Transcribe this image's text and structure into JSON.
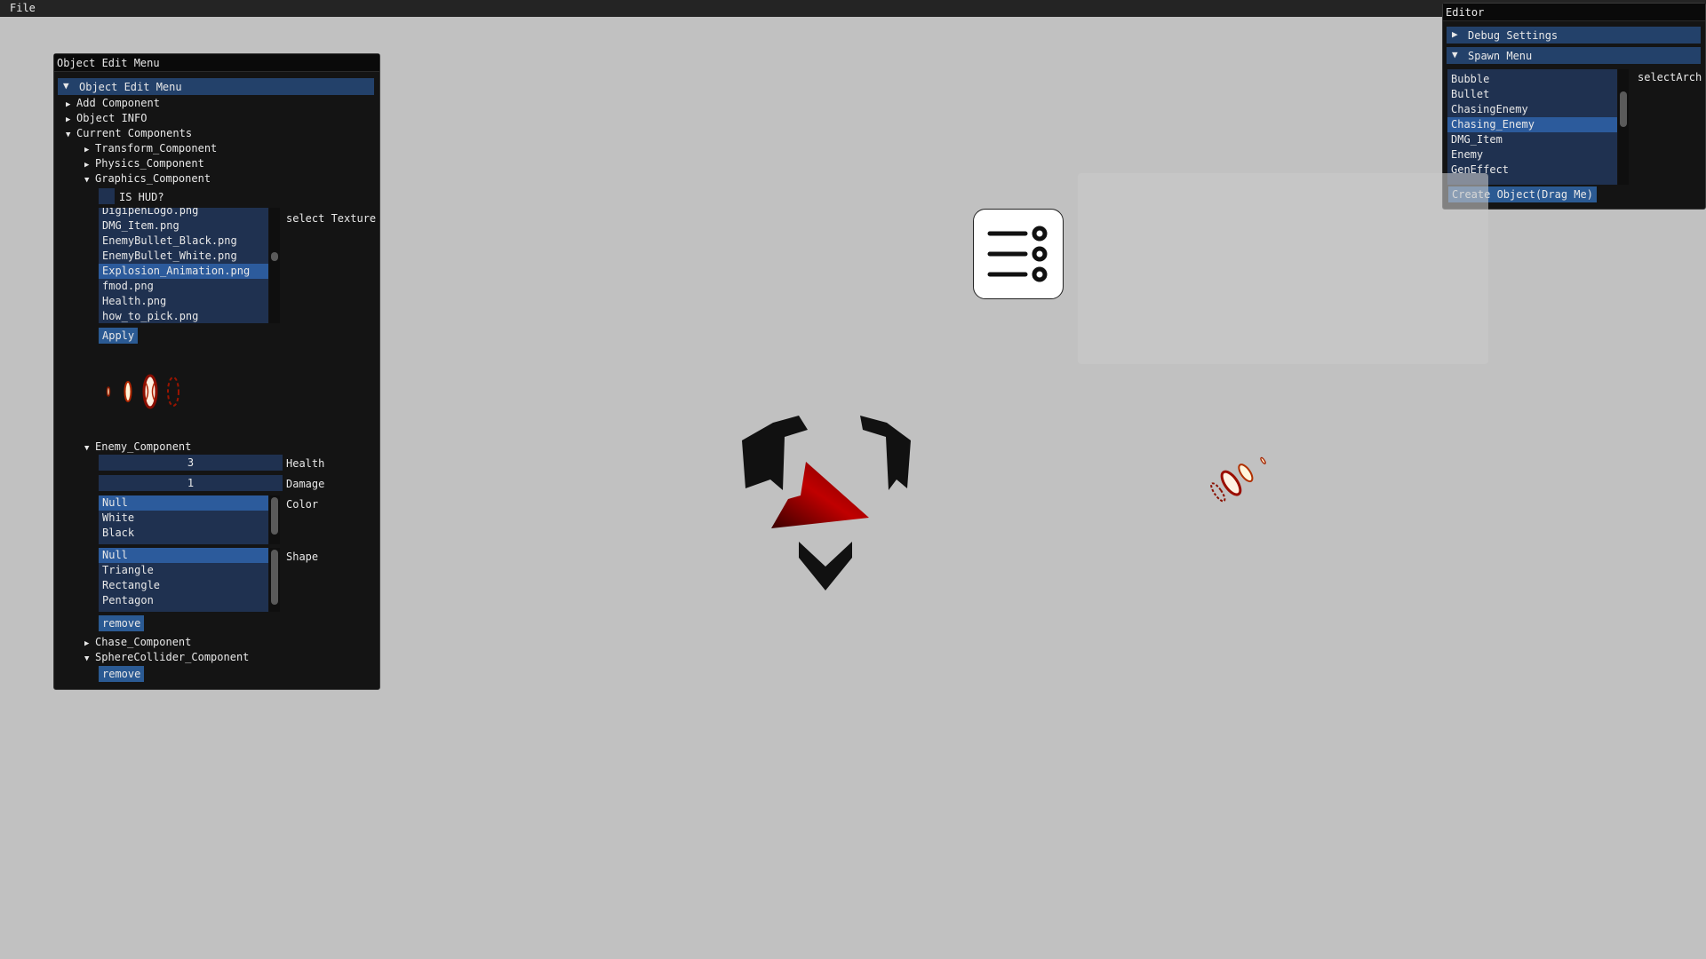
{
  "menubar": {
    "file": "File"
  },
  "object_edit": {
    "title": "Object Edit Menu",
    "header": "Object Edit Menu",
    "nodes": {
      "add_component": "Add Component",
      "object_info": "Object INFO",
      "current_components": "Current Components",
      "transform": "Transform_Component",
      "physics": "Physics_Component",
      "graphics": "Graphics_Component",
      "is_hud": "IS HUD?",
      "enemy": "Enemy_Component",
      "chase": "Chase_Component",
      "sphere": "SphereCollider_Component"
    },
    "textures": [
      "DigipenLogo.png",
      "DMG_Item.png",
      "EnemyBullet_Black.png",
      "EnemyBullet_White.png",
      "Explosion_Animation.png",
      "fmod.png",
      "Health.png",
      "how_to_pick.png"
    ],
    "texture_selected": "Explosion_Animation.png",
    "select_texture_label": "select Texture",
    "apply": "Apply",
    "health_value": "3",
    "health_label": "Health",
    "damage_value": "1",
    "damage_label": "Damage",
    "colors": [
      "Null",
      "White",
      "Black"
    ],
    "color_label": "Color",
    "shapes": [
      "Null",
      "Triangle",
      "Rectangle",
      "Pentagon"
    ],
    "shape_label": "Shape",
    "remove": "remove",
    "remove2": "remove"
  },
  "editor": {
    "title": "Editor",
    "debug": "Debug Settings",
    "spawn": "Spawn Menu",
    "archetypes": [
      "Bubble",
      "Bullet",
      "ChasingEnemy",
      "Chasing_Enemy",
      "DMG_Item",
      "Enemy",
      "GenEffect"
    ],
    "arch_selected": "Chasing_Enemy",
    "select_arch": "selectArch",
    "create": "Create Object(Drag Me)"
  },
  "colors": {
    "background": "#c1c1c1",
    "header": "#23416a",
    "selection": "#2c5b9c",
    "enemy_red": "#b00000"
  }
}
